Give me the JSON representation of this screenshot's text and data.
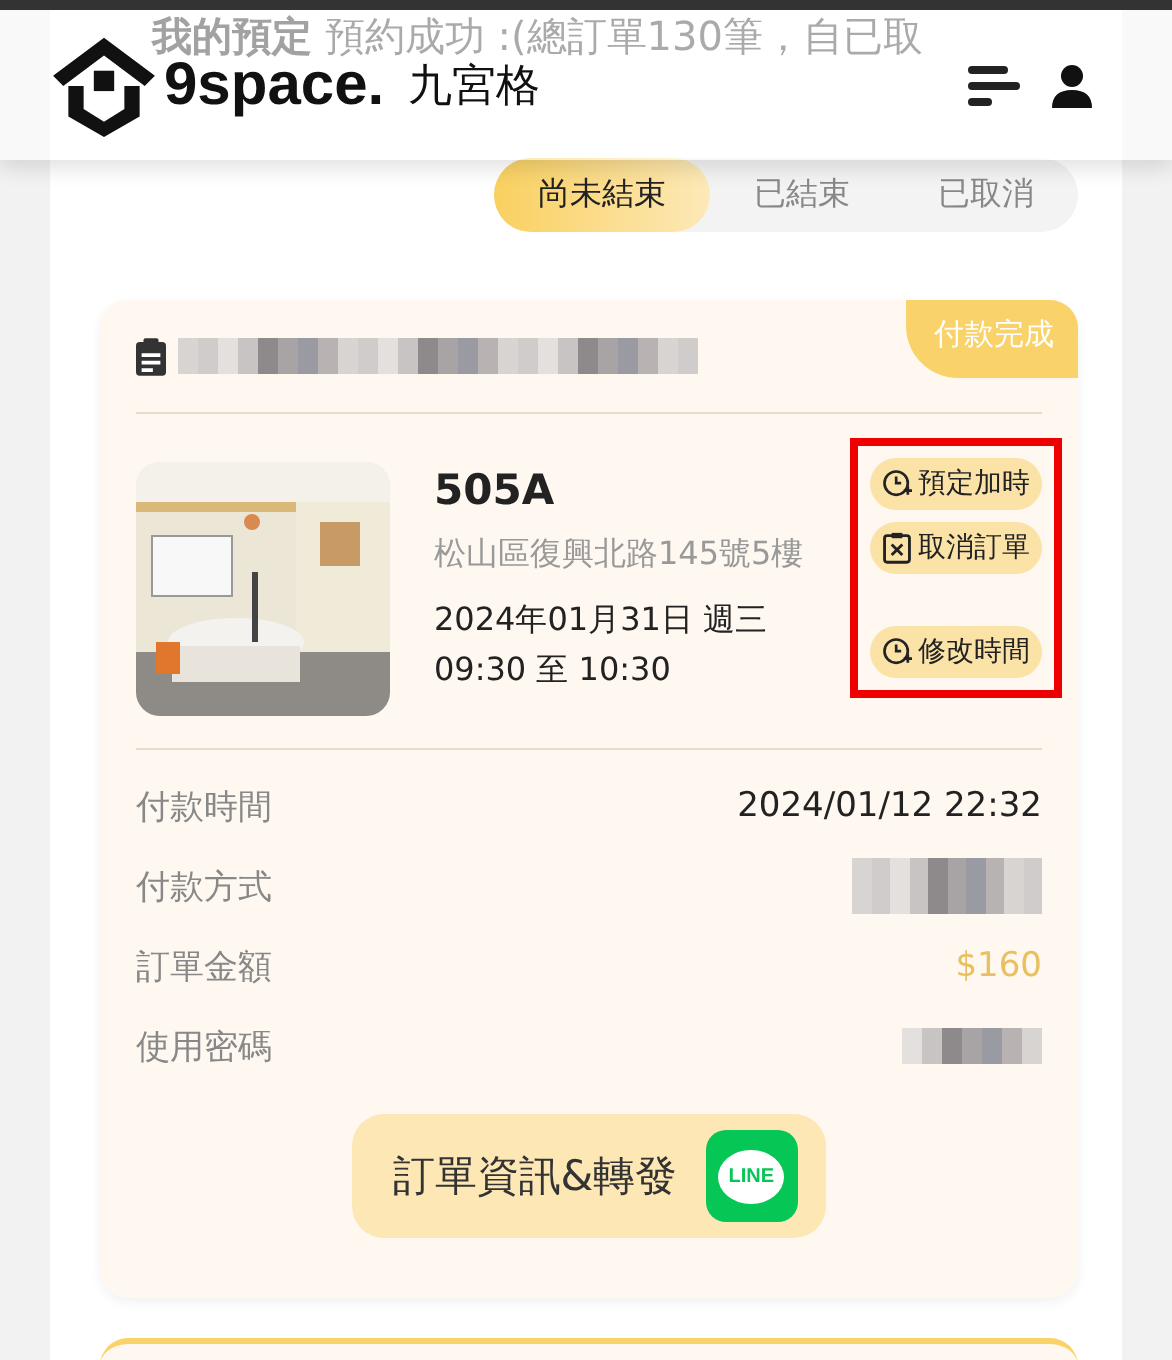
{
  "header": {
    "brand": "9space.",
    "brand_cn": "九宮格"
  },
  "page_heading": {
    "title": "我的預定",
    "summary": "預約成功 :(總訂單130筆，自已取"
  },
  "tabs": [
    {
      "label": "尚未結束",
      "selected": true
    },
    {
      "label": "已結束",
      "selected": false
    },
    {
      "label": "已取消",
      "selected": false
    }
  ],
  "order": {
    "status": "付款完成",
    "room": "505A",
    "address": "松山區復興北路145號5樓",
    "date": "2024年01月31日 週三",
    "time": "09:30 至 10:30",
    "actions": [
      {
        "kind": "extend",
        "label": "預定加時"
      },
      {
        "kind": "cancel",
        "label": "取消訂單"
      },
      {
        "kind": "reschedule",
        "label": "修改時間"
      }
    ],
    "details": [
      {
        "label": "付款時間",
        "value": "2024/01/12 22:32",
        "kind": "text"
      },
      {
        "label": "付款方式",
        "kind": "redacted"
      },
      {
        "label": "訂單金額",
        "value": "$160",
        "kind": "amount"
      },
      {
        "label": "使用密碼",
        "kind": "redacted"
      }
    ],
    "share_button": "訂單資訊&轉發",
    "line_logo": "LINE"
  }
}
